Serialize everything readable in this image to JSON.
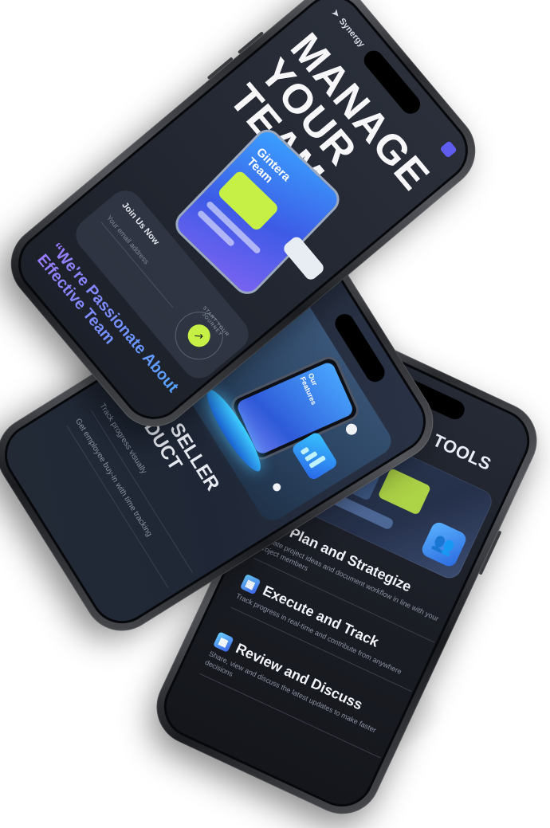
{
  "phone_top": {
    "brand": "Synergy",
    "headline": [
      "MANAGE",
      "YOUR",
      "TEAM"
    ],
    "card_title": [
      "Gintera",
      "Team"
    ],
    "join_label": "Join Us Now",
    "join_placeholder": "Your email address",
    "start_badge_text": "START YOUR JOURNEY",
    "start_badge_icon": "↗",
    "quote": "“We're Passionate About Effective Team"
  },
  "phone_middle": {
    "card_title": [
      "Our",
      "Features"
    ],
    "title": [
      "BEST SELLER",
      "PRODUCT"
    ],
    "items": [
      "Track progress visually",
      "Get employee buy-in with time tracking"
    ]
  },
  "phone_bottom": {
    "title": "ADVANCED TOOLS",
    "team_icon": "👥",
    "features": [
      {
        "icon": "▦",
        "title": "Plan and Strategize",
        "desc": "Create project ideas and document workflow in line with your project members"
      },
      {
        "icon": "▦",
        "title": "Execute and Track",
        "desc": "Track progress in real-time and contribute from anywhere"
      },
      {
        "icon": "▦",
        "title": "Review and Discuss",
        "desc": "Share, view and discuss the latest updates to make faster decisions"
      }
    ]
  },
  "colors": {
    "lime": "#c6f046",
    "accent_blue": "#3d5be6",
    "accent_purple": "#9a7cff",
    "screen_dark": "#1f2430"
  }
}
